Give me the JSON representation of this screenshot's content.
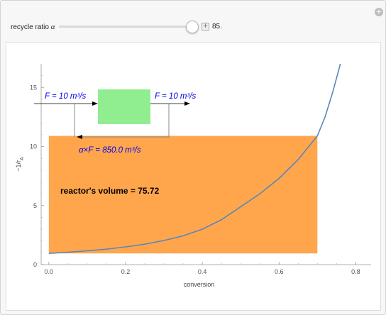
{
  "controls": {
    "recycle_label": "recycle ratio",
    "recycle_symbol": "α",
    "recycle_value": "85.",
    "recycle_slider_fraction": 0.9,
    "add_icon": "plus-icon",
    "corner_icon": "plus-circle-icon"
  },
  "chart_data": {
    "type": "line",
    "title": "",
    "xlabel": "conversion",
    "ylabel": "−1/r",
    "ylabel_sub": "A",
    "xlim": [
      -0.02,
      0.84
    ],
    "ylim": [
      0,
      17
    ],
    "x_ticks": [
      "0.0",
      "0.2",
      "0.4",
      "0.6",
      "0.8"
    ],
    "y_ticks": [
      "0",
      "5",
      "10",
      "15"
    ],
    "curve": {
      "x": [
        0.0,
        0.05,
        0.1,
        0.15,
        0.2,
        0.25,
        0.3,
        0.35,
        0.4,
        0.45,
        0.5,
        0.55,
        0.6,
        0.65,
        0.7,
        0.72,
        0.74,
        0.76
      ],
      "y": [
        0.95,
        1.05,
        1.17,
        1.31,
        1.5,
        1.73,
        2.04,
        2.44,
        3.0,
        3.8,
        4.9,
        6.0,
        7.3,
        8.9,
        10.9,
        12.5,
        14.6,
        17.0
      ]
    },
    "rectangle": {
      "x": [
        0.0,
        0.7
      ],
      "y": [
        0.95,
        10.9
      ],
      "color": "#ffa64d"
    },
    "annotations": {
      "feed": "F = 10 m³/s",
      "outlet": "F = 10 m³/s",
      "recycle": "α×F = 850.0 m³/s",
      "volume": "reactor's volume = 75.72"
    },
    "colors": {
      "curve": "#5b87b9",
      "reactor": "#90ee90",
      "text": "#0000ee"
    },
    "grid": false,
    "legend": "none"
  }
}
